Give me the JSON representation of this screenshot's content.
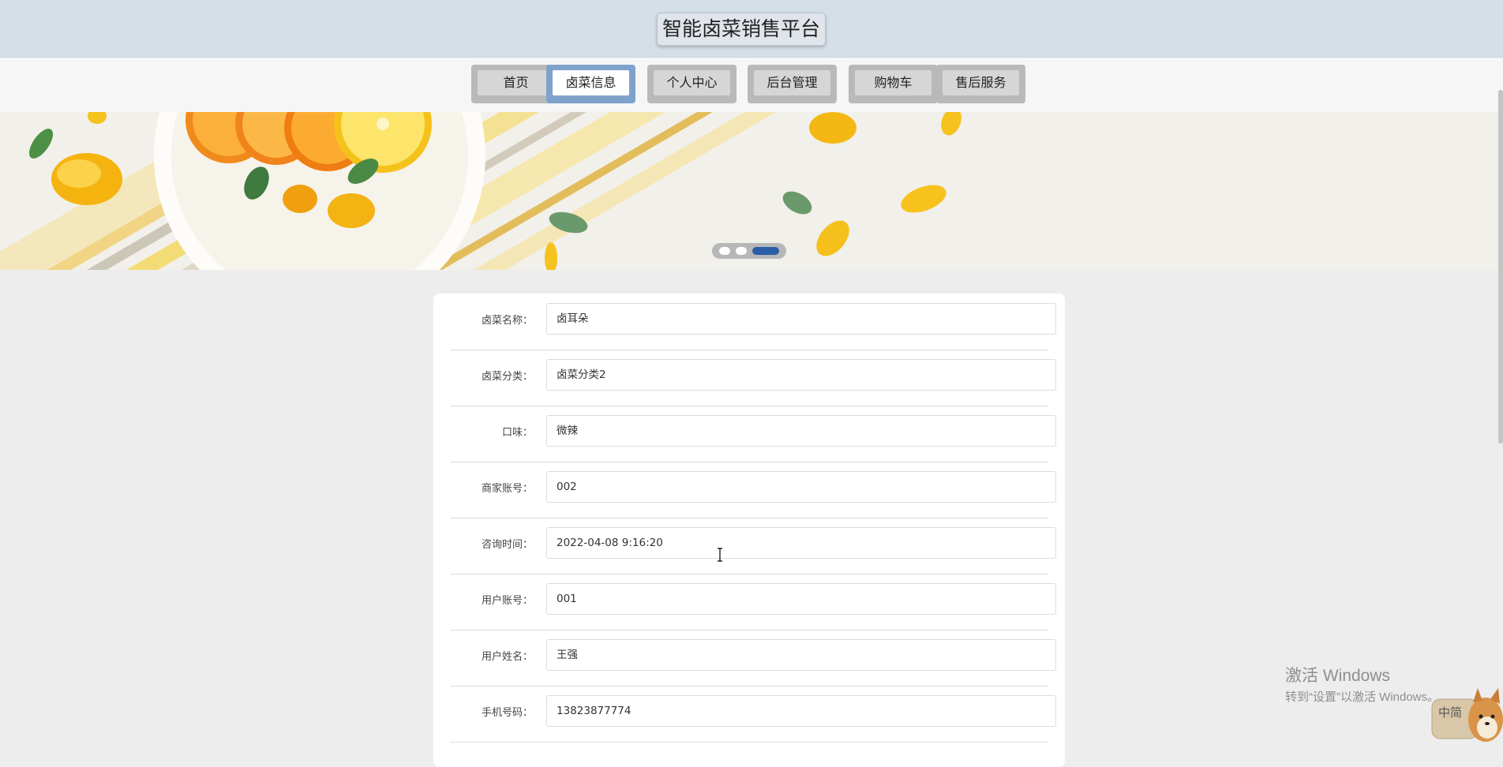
{
  "header": {
    "title": "智能卤菜销售平台"
  },
  "nav": {
    "items": [
      {
        "label": "首页"
      },
      {
        "label": "卤菜信息"
      },
      {
        "label": "个人中心"
      },
      {
        "label": "后台管理"
      },
      {
        "label": "购物车"
      },
      {
        "label": "售后服务"
      }
    ],
    "active_index": 1
  },
  "banner": {
    "slide_count": 3,
    "active_slide": 3
  },
  "form": {
    "fields": [
      {
        "label": "卤菜名称：",
        "value": "卤耳朵"
      },
      {
        "label": "卤菜分类：",
        "value": "卤菜分类2"
      },
      {
        "label": "口味：",
        "value": "微辣"
      },
      {
        "label": "商家账号：",
        "value": "002"
      },
      {
        "label": "咨询时间：",
        "value": "2022-04-08 9:16:20"
      },
      {
        "label": "用户账号：",
        "value": "001"
      },
      {
        "label": "用户姓名：",
        "value": "王强"
      },
      {
        "label": "手机号码：",
        "value": "13823877774"
      }
    ]
  },
  "watermark": {
    "line1": "激活 Windows",
    "line2": "转到“设置”以激活 Windows。"
  },
  "ime": {
    "label": "中简"
  },
  "colors": {
    "header_bg": "#d5dfe8",
    "nav_active_border": "#7fa2cc",
    "page_bg": "#ededed",
    "dot_active": "#2b5ea6"
  },
  "icons": [
    "text-cursor-icon",
    "shiba-dog-icon"
  ]
}
